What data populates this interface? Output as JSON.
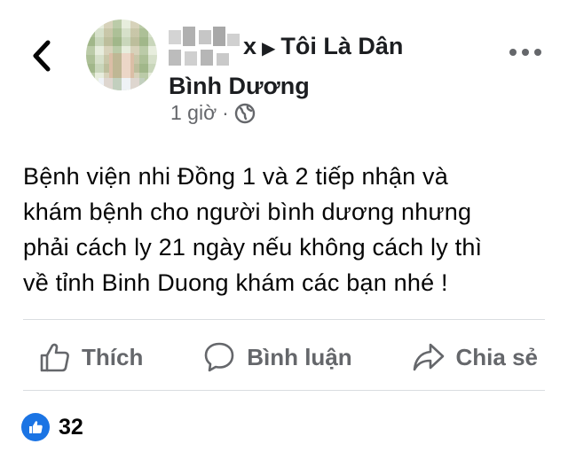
{
  "header": {
    "author_suffix": "x",
    "group_name_line1": "Tôi Là Dân",
    "group_name_line2": "Bình Dương",
    "time": "1 giờ",
    "separator": "·",
    "privacy_icon": "globe-icon",
    "back_icon": "chevron-left-icon",
    "more_icon": "more-horizontal-icon"
  },
  "post": {
    "text_lines": [
      "Bệnh viện nhi Đồng 1 và 2 tiếp nhận và",
      "khám bệnh cho người bình dương nhưng",
      "phải cách ly 21 ngày nếu không cách ly thì",
      "về tỉnh Binh Duong khám các bạn nhé !"
    ]
  },
  "actions": {
    "like_label": "Thích",
    "comment_label": "Bình luận",
    "share_label": "Chia sẻ"
  },
  "reactions": {
    "like_count": "32"
  },
  "colors": {
    "text": "#050505",
    "secondary": "#65676b",
    "like_blue": "#1b74e4",
    "divider": "#dadde1"
  }
}
